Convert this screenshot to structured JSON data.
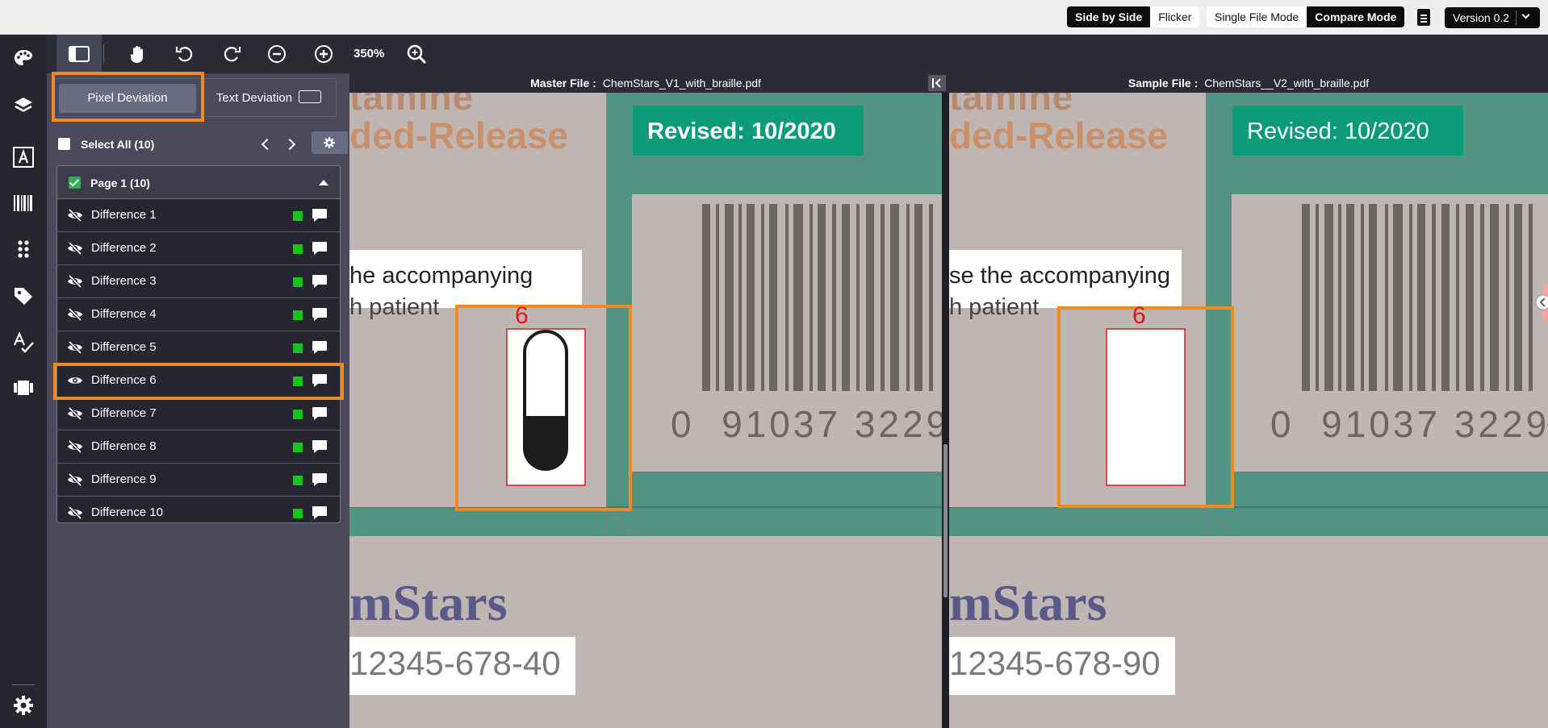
{
  "topbar": {
    "view_modes": [
      "Side by Side",
      "Flicker"
    ],
    "file_modes": [
      "Single File Mode",
      "Compare Mode"
    ],
    "version_label": "Version 0.2"
  },
  "toolbar": {
    "zoom": "350%"
  },
  "sidebar": {
    "tabs": {
      "pixel": "Pixel Deviation",
      "text": "Text Deviation"
    },
    "select_all": "Select All (10)",
    "page_group": "Page 1 (10)",
    "differences": [
      {
        "label": "Difference 1",
        "visible": false
      },
      {
        "label": "Difference 2",
        "visible": false
      },
      {
        "label": "Difference 3",
        "visible": false
      },
      {
        "label": "Difference 4",
        "visible": false
      },
      {
        "label": "Difference 5",
        "visible": false
      },
      {
        "label": "Difference 6",
        "visible": true
      },
      {
        "label": "Difference 7",
        "visible": false
      },
      {
        "label": "Difference 8",
        "visible": false
      },
      {
        "label": "Difference 9",
        "visible": false
      },
      {
        "label": "Difference 10",
        "visible": false
      }
    ]
  },
  "viewer": {
    "master_label": "Master File :",
    "master_file": "ChemStars_V1_with_braille.pdf",
    "sample_label": "Sample File :",
    "sample_file": "ChemStars__V2_with_braille.pdf",
    "master": {
      "top_text": "tamine",
      "release_text": "ded-Release",
      "revised": "Revised: 10/2020",
      "accompanying": "he accompanying",
      "patient": "h patient",
      "barcode_number": "0  91037 3229",
      "marker": "6",
      "brand": "mStars",
      "ndc": "12345-678-40"
    },
    "sample": {
      "top_text": "tamine",
      "release_text": "ded-Release",
      "revised": "Revised: 10/2020",
      "accompanying": "se the accompanying",
      "patient": "h patient",
      "barcode_number": "0  91037 3229",
      "marker": "6",
      "brand": "mStars",
      "ndc": "12345-678-90"
    }
  },
  "colors": {
    "accent": "#f08a24",
    "teal": "#529382",
    "badge": "#0b9b79",
    "marker": "#e0161b",
    "diff_ok": "#17c41c"
  }
}
